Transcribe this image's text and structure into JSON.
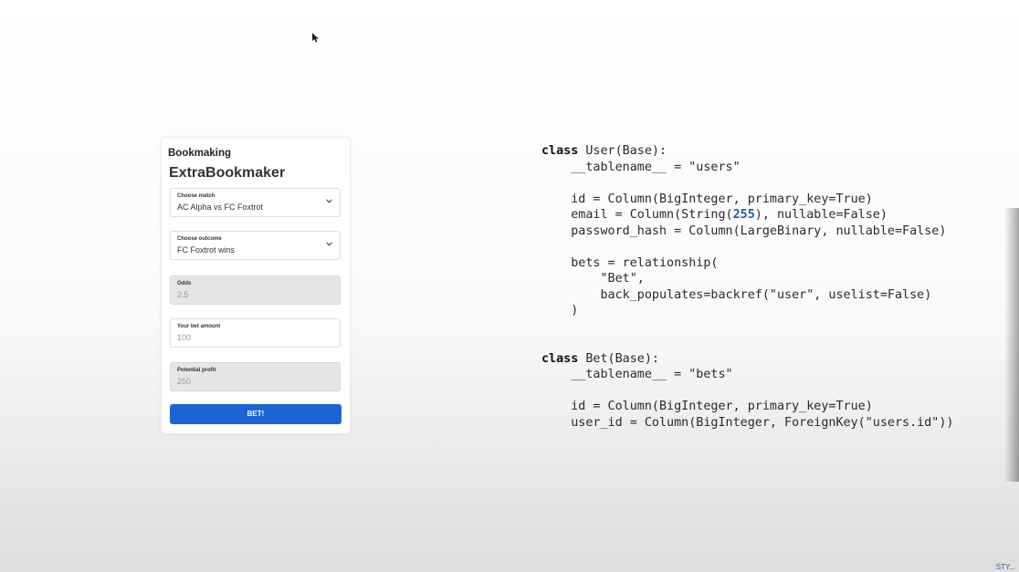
{
  "form": {
    "app_name": "Bookmaking",
    "title": "ExtraBookmaker",
    "match": {
      "label": "Choose match",
      "value": "AC Alpha vs FC Foxtrot"
    },
    "outcome": {
      "label": "Choose outcome",
      "value": "FC Foxtrot wins"
    },
    "odds": {
      "label": "Odds",
      "value": "2.5"
    },
    "bet_amount": {
      "label": "Your bet amount",
      "placeholder": "100"
    },
    "profit": {
      "label": "Potential profit",
      "value": "250"
    },
    "bet_button": "BET!"
  },
  "code": {
    "user_class_head": "class User(Base):",
    "user_table": "    __tablename__ = \"users\"",
    "user_id": "    id = Column(BigInteger, primary_key=True)",
    "user_email_pre": "    email = Column(String(",
    "user_email_num": "255",
    "user_email_post": "), nullable=False)",
    "user_pwd": "    password_hash = Column(LargeBinary, nullable=False)",
    "user_rel_1": "    bets = relationship(",
    "user_rel_2": "        \"Bet\",",
    "user_rel_3": "        back_populates=backref(\"user\", uselist=False)",
    "user_rel_4": "    )",
    "bet_class_head": "class Bet(Base):",
    "bet_table": "    __tablename__ = \"bets\"",
    "bet_id": "    id = Column(BigInteger, primary_key=True)",
    "bet_user_id": "    user_id = Column(BigInteger, ForeignKey(\"users.id\"))"
  },
  "corner_text": "STY..."
}
